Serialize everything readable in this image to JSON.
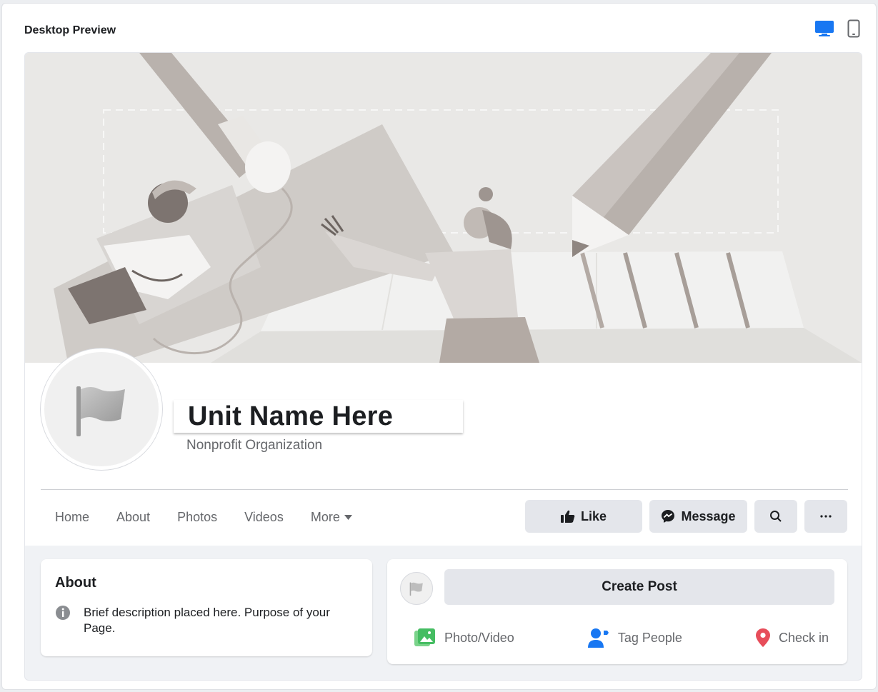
{
  "preview": {
    "title": "Desktop Preview",
    "desktop_icon": "desktop-icon",
    "mobile_icon": "mobile-icon",
    "accent_color": "#1877f2"
  },
  "profile": {
    "name": "Unit Name Here",
    "category": "Nonprofit Organization",
    "avatar_icon": "flag-icon"
  },
  "nav": {
    "items": [
      {
        "label": "Home"
      },
      {
        "label": "About"
      },
      {
        "label": "Photos"
      },
      {
        "label": "Videos"
      },
      {
        "label": "More"
      }
    ]
  },
  "actions": {
    "like_label": "Like",
    "message_label": "Message"
  },
  "about": {
    "title": "About",
    "description": "Brief description placed here. Purpose of your Page."
  },
  "post": {
    "create_label": "Create Post",
    "photo_video_label": "Photo/Video",
    "tag_people_label": "Tag People",
    "check_in_label": "Check in"
  }
}
